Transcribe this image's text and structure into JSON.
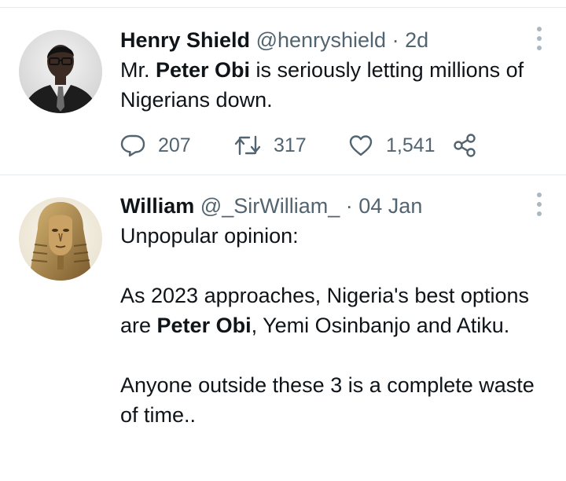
{
  "tweets": [
    {
      "name": "Henry Shield",
      "handle": "@henryshield",
      "separator": "·",
      "time": "2d",
      "avatar_icon": "profile-photo-man-in-suit-with-glasses",
      "body_parts": [
        {
          "text": "Mr. ",
          "bold": false
        },
        {
          "text": "Peter Obi",
          "bold": true
        },
        {
          "text": " is seriously letting millions of Nigerians down.",
          "bold": false
        }
      ],
      "replies": "207",
      "retweets": "317",
      "likes": "1,541"
    },
    {
      "name": "William",
      "handle": "@_SirWilliam_",
      "separator": "·",
      "time": "04 Jan",
      "avatar_icon": "profile-photo-pharaoh-statue",
      "paragraphs": [
        [
          {
            "text": "Unpopular opinion:",
            "bold": false
          }
        ],
        [],
        [
          {
            "text": "As 2023 approaches, Nigeria's best options are ",
            "bold": false
          },
          {
            "text": "Peter Obi",
            "bold": true
          },
          {
            "text": ", Yemi Osinbanjo and Atiku.",
            "bold": false
          }
        ],
        [],
        [
          {
            "text": "Anyone outside these 3 is a complete waste of time..",
            "bold": false
          }
        ]
      ]
    }
  ],
  "colors": {
    "text": "#0f1419",
    "secondary": "#536471",
    "divider": "#e6ecf0",
    "more_dots": "#aab8c2"
  },
  "icons": {
    "reply": "reply-icon",
    "retweet": "retweet-icon",
    "like": "heart-icon",
    "share": "share-icon",
    "more": "more-options-icon"
  }
}
